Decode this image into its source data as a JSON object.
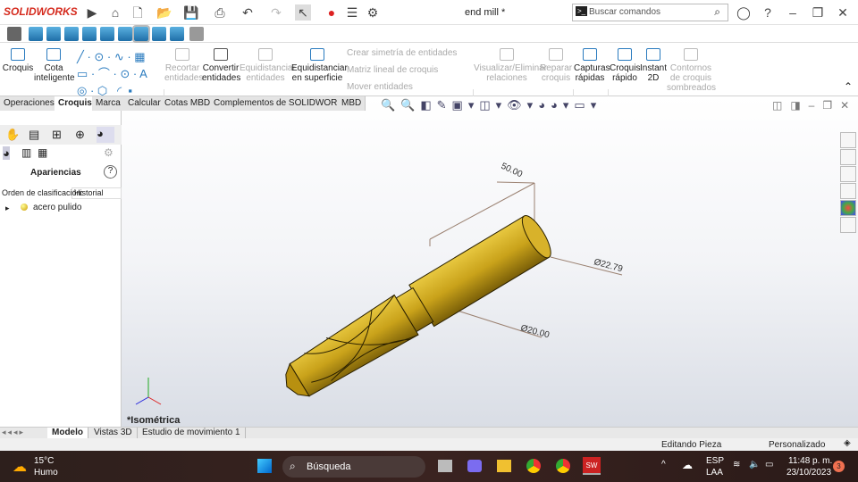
{
  "app": {
    "logo": "SOLIDWORKS",
    "title": "end mill *",
    "search_placeholder": "Buscar comandos"
  },
  "command_manager": {
    "buttons": [
      {
        "label": "Croquis",
        "enabled": true
      },
      {
        "label": "Cota inteligente",
        "enabled": true
      },
      {
        "label": "Recortar entidades",
        "enabled": false
      },
      {
        "label": "Convertir entidades",
        "enabled": true
      },
      {
        "label": "Equidistanciar entidades",
        "enabled": false
      },
      {
        "label": "Equidistanciar en superficie",
        "enabled": true
      },
      {
        "label": "Visualizar/Eliminar relaciones",
        "enabled": false
      },
      {
        "label": "Reparar croquis",
        "enabled": false
      },
      {
        "label": "Capturas rápidas",
        "enabled": true
      },
      {
        "label": "Croquis rápido",
        "enabled": true
      },
      {
        "label": "Instant 2D",
        "enabled": true
      },
      {
        "label": "Contornos de croquis sombreados",
        "enabled": false
      }
    ],
    "small": [
      "Crear simetría de entidades",
      "Matriz lineal de croquis",
      "Mover entidades"
    ]
  },
  "tabs": [
    {
      "label": "Operaciones"
    },
    {
      "label": "Croquis",
      "active": true
    },
    {
      "label": "Marca"
    },
    {
      "label": "Calcular"
    },
    {
      "label": "Cotas MBD"
    },
    {
      "label": "Complementos de SOLIDWORKS"
    },
    {
      "label": "MBD"
    }
  ],
  "left_panel": {
    "title": "Apariencias",
    "sort_label": "Orden de clasificación:",
    "sort_value": "Historial",
    "items": [
      {
        "label": "acero pulido"
      }
    ]
  },
  "viewport": {
    "view_name": "*Isométrica",
    "dimensions": [
      "50.00",
      "Ø22.79",
      "Ø20.00"
    ],
    "part_color": "#c9a21a"
  },
  "bottom_tabs": [
    {
      "label": "Modelo",
      "active": true
    },
    {
      "label": "Vistas 3D"
    },
    {
      "label": "Estudio de movimiento 1"
    }
  ],
  "status": {
    "mode": "Editando Pieza",
    "units": "Personalizado"
  },
  "taskbar": {
    "weather_temp": "15°C",
    "weather_desc": "Humo",
    "search": "Búsqueda",
    "lang1": "ESP",
    "lang2": "LAA",
    "time": "11:48 p. m.",
    "date": "23/10/2023",
    "notif": "3"
  }
}
